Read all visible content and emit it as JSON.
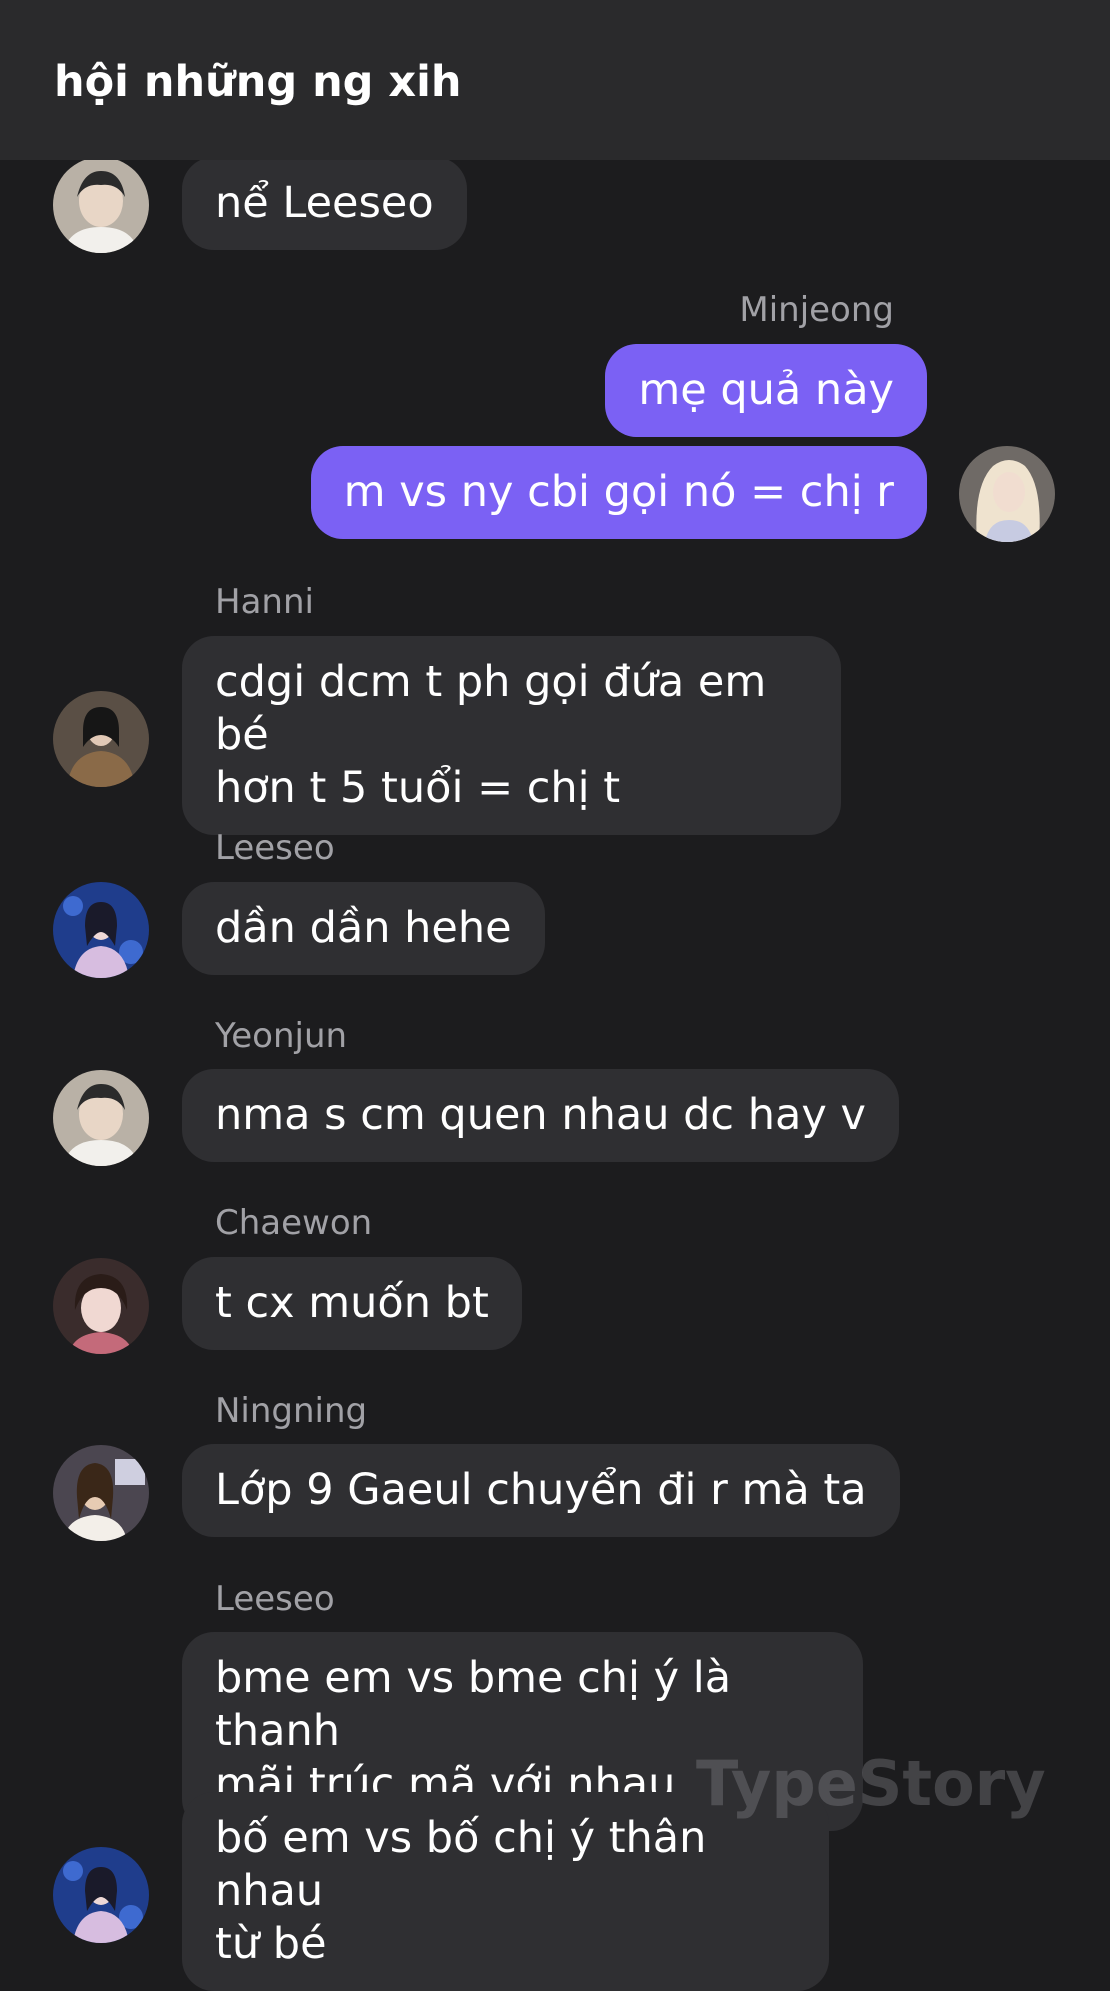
{
  "header": {
    "title": "hội những ng xih"
  },
  "messages": {
    "m1": {
      "text": "nể Leeseo"
    },
    "m2": {
      "sender": "Minjeong",
      "text": "mẹ quả này"
    },
    "m3": {
      "text": "m vs ny cbi gọi nó = chị r"
    },
    "m4": {
      "sender": "Hanni",
      "line1": "cdgi dcm t ph gọi đứa em bé",
      "line2": "hơn t 5 tuổi = chị t"
    },
    "m5": {
      "sender": "Leeseo",
      "text": "dần dần hehe"
    },
    "m6": {
      "sender": "Yeonjun",
      "text": "nma s cm quen nhau dc hay v"
    },
    "m7": {
      "sender": "Chaewon",
      "text": "t cx muốn bt"
    },
    "m8": {
      "sender": "Ningning",
      "text": "Lớp 9 Gaeul chuyển đi r mà ta"
    },
    "m9": {
      "sender": "Leeseo",
      "line1": "bme em vs bme chị ý là thanh",
      "line2": "mãi trúc mã với nhau"
    },
    "m10": {
      "line1": "bố em vs bố chị ý thân nhau",
      "line2": "từ bé"
    }
  },
  "watermark": "TypeStory",
  "colors": {
    "background": "#1c1c1e",
    "header": "#2a2a2c",
    "bubble_incoming": "#2f2f32",
    "bubble_outgoing": "#7b61f4",
    "sender_name": "#a1a1a6"
  },
  "avatars": {
    "yeonjun": "avatar-yeonjun",
    "minjeong": "avatar-minjeong",
    "hanni": "avatar-hanni",
    "leeseo": "avatar-leeseo",
    "chaewon": "avatar-chaewon",
    "ningning": "avatar-ningning"
  }
}
